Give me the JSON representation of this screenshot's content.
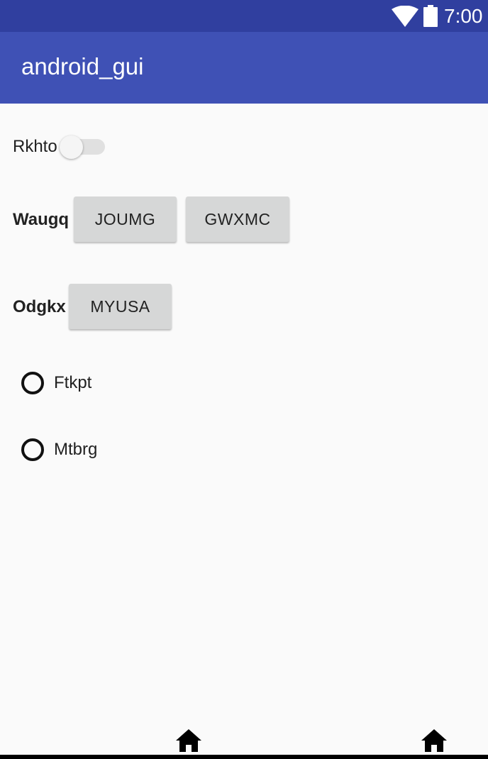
{
  "status_bar": {
    "time": "7:00",
    "icons": [
      "wifi-icon",
      "battery-icon"
    ]
  },
  "app_bar": {
    "title": "android_gui"
  },
  "switch_row": {
    "label": "Rkhto",
    "checked": false
  },
  "button_row_1": {
    "label": "Waugq",
    "buttons": [
      "JOUMG",
      "GWXMC"
    ]
  },
  "button_row_2": {
    "label": "Odgkx",
    "buttons": [
      "MYUSA"
    ]
  },
  "radios": [
    {
      "label": "Ftkpt",
      "checked": false
    },
    {
      "label": "Mtbrg",
      "checked": false
    }
  ],
  "bottom_nav": {
    "icons": [
      "home-icon",
      "home-icon"
    ]
  },
  "colors": {
    "status_bar": "#303f9f",
    "app_bar": "#3f51b5",
    "background": "#fafafa",
    "button": "#d6d7d7"
  }
}
